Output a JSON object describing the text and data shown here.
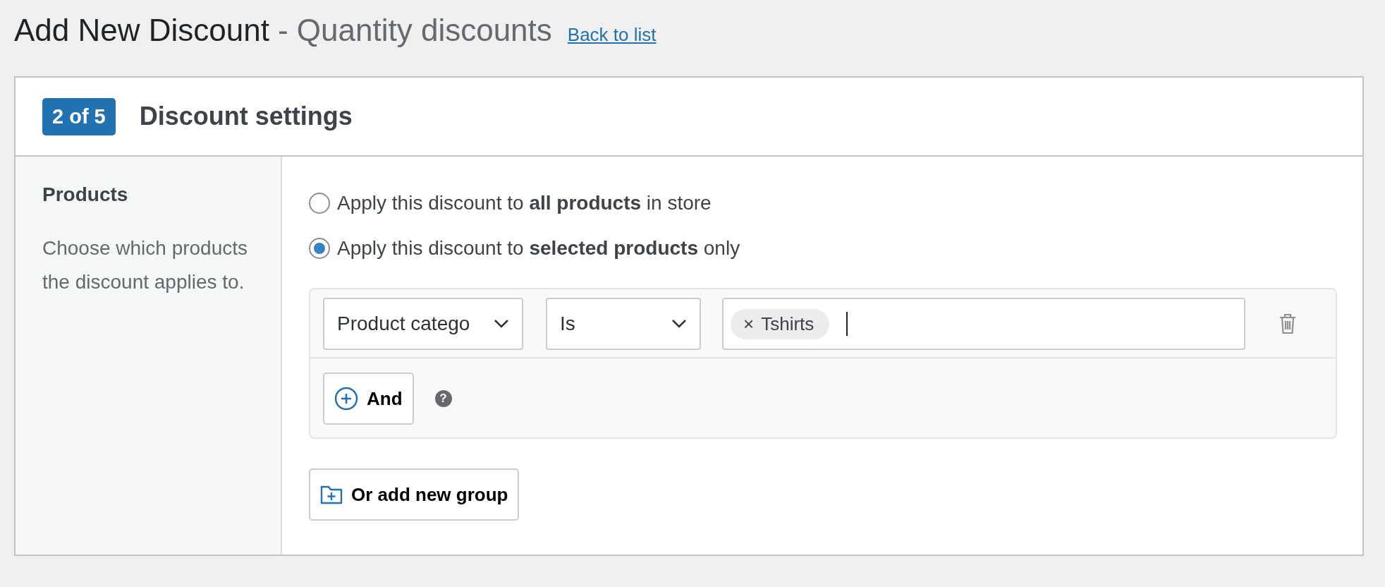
{
  "page_title": {
    "main": "Add New Discount",
    "separator": "-",
    "subtitle": "Quantity discounts",
    "back_link": "Back to list"
  },
  "card": {
    "step_badge": "2 of 5",
    "title": "Discount settings"
  },
  "section": {
    "heading": "Products",
    "description": "Choose which products the discount applies to."
  },
  "scope_options": [
    {
      "label": "Apply this discount to **all products** in store",
      "selected": false
    },
    {
      "label": "Apply this discount to **selected products** only",
      "selected": true
    }
  ],
  "condition_group": {
    "conditions": [
      {
        "field": "Product catego",
        "operator": "Is",
        "tags": [
          {
            "remove": "×",
            "label": "Tshirts"
          }
        ]
      }
    ],
    "and_button": "And",
    "help": "?"
  },
  "add_group_button": "Or add new group"
}
